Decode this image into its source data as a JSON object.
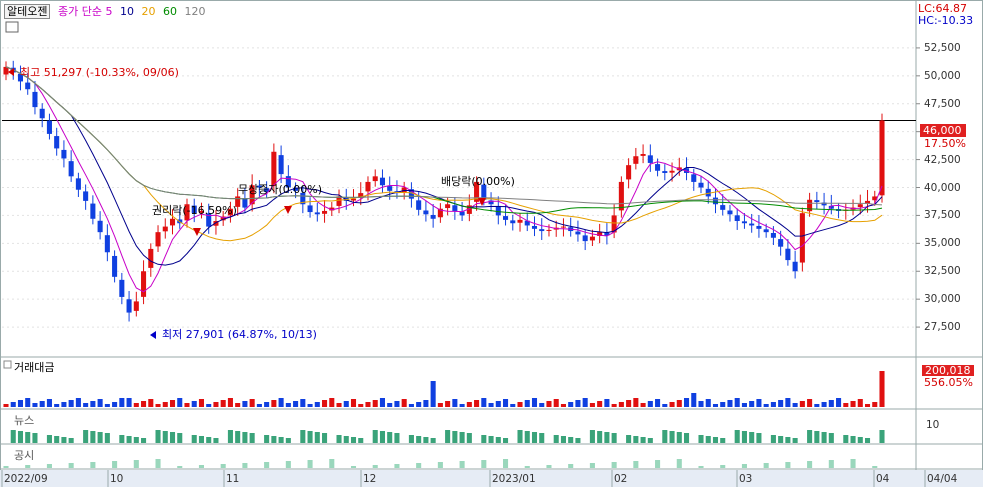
{
  "legend": {
    "symbol": "알테오젠",
    "items": [
      {
        "label": "종가 단순 5",
        "color": "#c800c8"
      },
      {
        "label": "10",
        "color": "#00008c"
      },
      {
        "label": "20",
        "color": "#e6a000"
      },
      {
        "label": "60",
        "color": "#008c00"
      },
      {
        "label": "120",
        "color": "#808080"
      }
    ]
  },
  "header_right": {
    "lc": "LC:64.87",
    "hc": "HC:-10.33"
  },
  "chart_data": {
    "type": "candlestick",
    "y_ticks": [
      "52,500",
      "50,000",
      "47,500",
      "45,000",
      "42,500",
      "40,000",
      "37,500",
      "35,000",
      "32,500",
      "30,000",
      "27,500"
    ],
    "ylim": [
      25000,
      55000
    ],
    "x_labels": [
      "2022/09",
      "10",
      "11",
      "12",
      "2023/01",
      "02",
      "03",
      "04",
      "04/04"
    ],
    "current_price": {
      "label": "46,000",
      "pct": "17.50%",
      "value": 46000
    },
    "annotations": [
      {
        "text": "최고 51,297 (-10.33%, 09/06)",
        "color": "#d40000",
        "price": 51297
      },
      {
        "text": "최저 27,901 (64.87%, 10/13)",
        "color": "#0000c8",
        "price": 27901
      },
      {
        "text": "권리락(-16.59%)",
        "color": "#000000"
      },
      {
        "text": "무상증자(0.00%)",
        "color": "#000000"
      },
      {
        "text": "배당락(0.00%)",
        "color": "#000000"
      }
    ],
    "candles_close": [
      50800,
      50300,
      49500,
      48800,
      47200,
      46200,
      44800,
      43500,
      42600,
      41000,
      39800,
      38800,
      37200,
      36000,
      34200,
      32000,
      30200,
      28800,
      29800,
      32500,
      34500,
      36000,
      36500,
      37200,
      36800,
      38500,
      37700,
      37900,
      36500,
      37000,
      37400,
      38100,
      39200,
      38200,
      40200,
      40000,
      39600,
      43200,
      41200,
      40000,
      39700,
      38500,
      37800,
      37600,
      37900,
      38200,
      39200,
      38800,
      39000,
      39500,
      40500,
      41000,
      40200,
      39700,
      39500,
      40000,
      39000,
      38000,
      37600,
      37200,
      38100,
      38500,
      37900,
      37500,
      38400,
      40500,
      38900,
      38500,
      37500,
      37100,
      36800,
      37100,
      36600,
      36300,
      36100,
      36200,
      36400,
      36500,
      36100,
      35800,
      35200,
      35600,
      36000,
      35700,
      37500,
      40500,
      42000,
      42800,
      43000,
      42200,
      41500,
      41300,
      41500,
      41800,
      41300,
      40500,
      40000,
      39200,
      38500,
      38000,
      37600,
      37000,
      36800,
      36600,
      36300,
      36000,
      35500,
      34700,
      33500,
      32500,
      37700,
      38900,
      38700,
      38400,
      38100,
      37900,
      38000,
      38200,
      38500,
      38800,
      39200,
      46000
    ],
    "volume": {
      "title": "거래대금",
      "value": "200,018",
      "pct": "556.05%"
    },
    "news": {
      "title": "뉴스",
      "scale": "10"
    },
    "disclosure": {
      "title": "공시"
    }
  }
}
